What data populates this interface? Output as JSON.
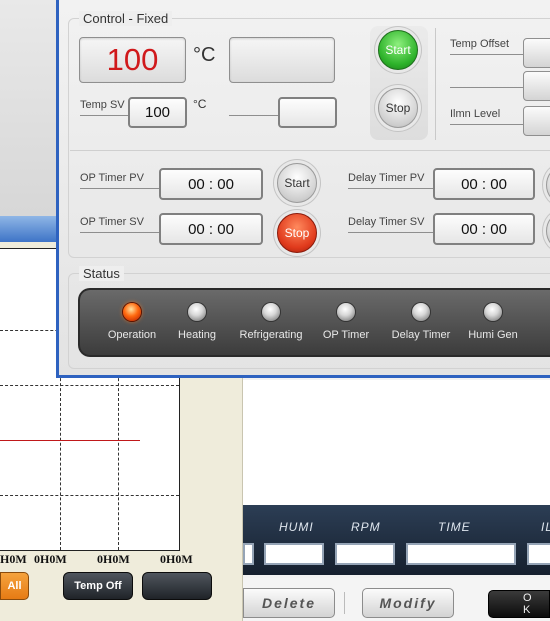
{
  "chart_panel": {
    "x_labels": [
      "0H0M",
      "0H0M",
      "0H0M",
      "0H0M"
    ],
    "buttons": {
      "all": "All",
      "temp_off": "Temp Off",
      "blank": ""
    }
  },
  "table": {
    "columns": [
      "HUMI",
      "RPM",
      "TIME",
      "IL"
    ],
    "buttons": {
      "delete": "Delete",
      "modify": "Modify",
      "ok": "O K"
    }
  },
  "dialog": {
    "control_group": "Control - Fixed",
    "temp_pv": "100",
    "temp_unit": "°C",
    "temp_sv_label": "Temp SV",
    "temp_sv_value": "100",
    "temp_sv_unit": "°C",
    "start": "Start",
    "stop": "Stop",
    "temp_offset_label": "Temp Offset",
    "ilmn_level_label": "Ilmn Level",
    "op_timer_pv_label": "OP Timer PV",
    "op_timer_pv": "00 : 00",
    "op_timer_sv_label": "OP Timer SV",
    "op_timer_sv": "00 : 00",
    "delay_timer_pv_label": "Delay Timer PV",
    "delay_timer_pv": "00 : 00",
    "delay_timer_sv_label": "Delay Timer SV",
    "delay_timer_sv": "00 : 00",
    "status_group": "Status",
    "status_items": [
      "Operation",
      "Heating",
      "Refrigerating",
      "OP Timer",
      "Delay Timer",
      "Humi Gen"
    ],
    "status_active": [
      true,
      false,
      false,
      false,
      false,
      false
    ]
  },
  "colors": {
    "accent_red": "#d0191b",
    "window_border": "#2e62c0",
    "led_on": "#ff6a10"
  }
}
